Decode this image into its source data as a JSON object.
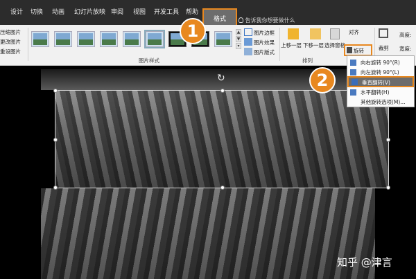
{
  "tabs": {
    "design": "设计",
    "transitions": "切换",
    "animations": "动画",
    "slideshow": "幻灯片放映",
    "review": "审阅",
    "view": "视图",
    "developer": "开发工具",
    "help": "帮助",
    "format": "格式"
  },
  "search": {
    "icon": "lightbulb-icon",
    "text": "告诉我你想要做什么"
  },
  "ribbon": {
    "adjust_items": [
      "压缩图片",
      "更改图片",
      "重设图片"
    ],
    "picture_styles_label": "图片样式",
    "border": "图片边框",
    "effects": "图片效果",
    "layout": "图片版式",
    "bring_forward": "上移一层",
    "send_backward": "下移一层",
    "selection_pane": "选择窗格",
    "align": "对齐",
    "rotate": "旋转",
    "arrange_label": "排列",
    "crop": "裁剪",
    "height_label": "高度:",
    "width_label": "宽度:"
  },
  "rotate_menu": [
    {
      "icon": "rotate-right-icon",
      "label": "向右旋转 90°(R)"
    },
    {
      "icon": "rotate-left-icon",
      "label": "向左旋转 90°(L)"
    },
    {
      "icon": "flip-vertical-icon",
      "label": "垂直翻转(V)"
    },
    {
      "icon": "flip-horizontal-icon",
      "label": "水平翻转(H)"
    },
    {
      "icon": "",
      "label": "其他旋转选项(M)..."
    }
  ],
  "badges": {
    "step1": "1",
    "step2": "2"
  },
  "watermark": "知乎 @津言",
  "colors": {
    "accent": "#e8881f",
    "tabbar": "#2c2c2c",
    "ribbon": "#f1f1f1"
  }
}
